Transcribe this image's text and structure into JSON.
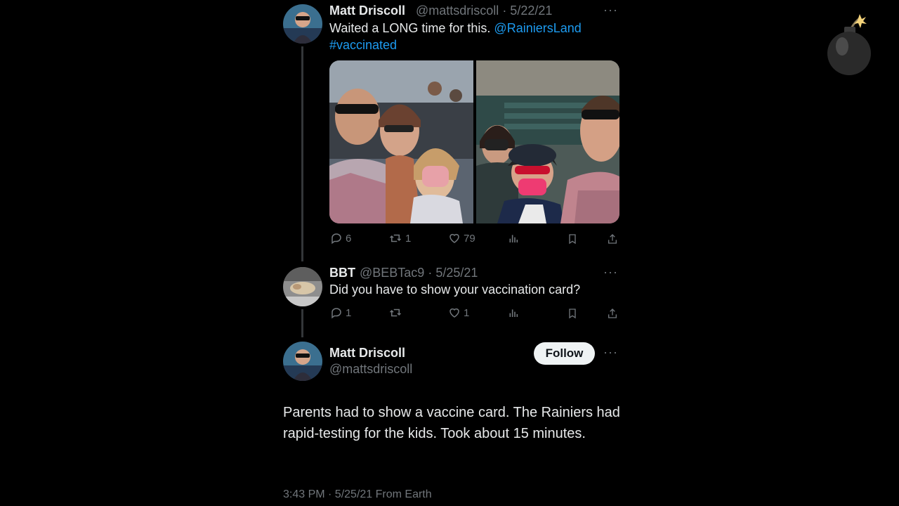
{
  "tweet1": {
    "name": "Matt Driscoll",
    "handle": "@mattsdriscoll",
    "date": "· 5/22/21",
    "text_plain": "Waited a LONG time for this.",
    "mention": "@RainiersLand",
    "hashtag": "#vaccinated",
    "more": "···",
    "replies": "6",
    "retweets": "1",
    "likes": "79"
  },
  "tweet2": {
    "name": "BBT",
    "handle": "@BEBTac9",
    "date": "· 5/25/21",
    "text": "Did you have to show your vaccination card?",
    "more": "···",
    "replies": "1",
    "likes": "1"
  },
  "main_tweet": {
    "name": "Matt Driscoll",
    "handle": "@mattsdriscoll",
    "follow_label": "Follow",
    "more": "···",
    "text": "Parents had to show a vaccine card. The Rainiers had rapid-testing for the kids. Took about 15 minutes.",
    "timestamp": "3:43 PM · 5/25/21 From Earth"
  },
  "icons": [
    "reply-icon",
    "retweet-icon",
    "like-icon",
    "views-icon",
    "bookmark-icon",
    "share-icon",
    "bomb-icon"
  ],
  "colors": {
    "background": "#000000",
    "link": "#1d9bf0",
    "muted": "#71767b",
    "text": "#e7e9ea"
  }
}
